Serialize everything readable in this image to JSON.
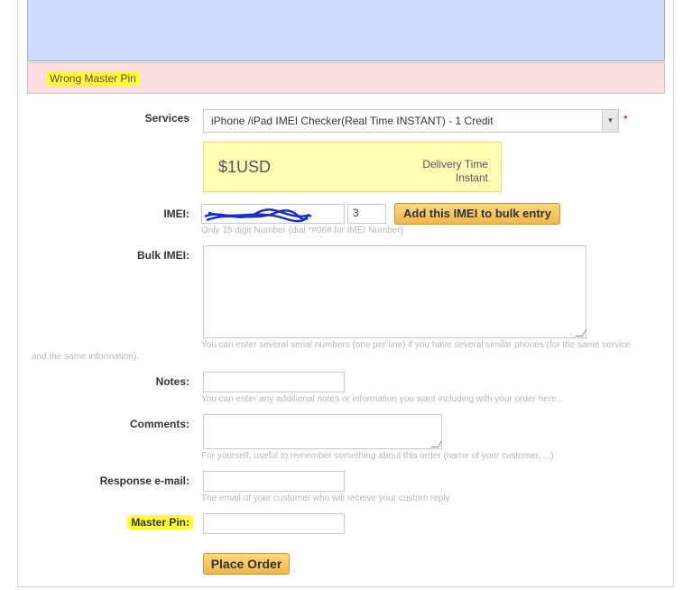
{
  "alert": {
    "message": "Wrong Master Pin"
  },
  "services": {
    "label": "Services",
    "selected": "iPhone /iPad IMEI Checker(Real Time INSTANT) - 1 Credit",
    "required_mark": "*"
  },
  "price": {
    "amount": "$1USD",
    "delivery_label": "Delivery Time",
    "delivery_value": "Instant"
  },
  "imei": {
    "label": "IMEI:",
    "value": "",
    "check_digit": "3",
    "add_button": "Add this IMEI to bulk entry",
    "hint": "Only 15 digit Number (dial *#06# for IMEI Number)"
  },
  "bulk": {
    "label": "Bulk IMEI:",
    "hint_line1": "You can enter several serial numbers (one per line) if you have several similar phones (for the same service",
    "hint_line2": "and the same information)."
  },
  "notes": {
    "label": "Notes:",
    "hint": "You can enter any additional notes or information you want including with your order here..."
  },
  "comments": {
    "label": "Comments:",
    "hint": "For yourself, useful to remember something about this order (name of your customer, ...)"
  },
  "response_email": {
    "label": "Response e-mail:",
    "hint": "The email of your customer who will receive your custom reply"
  },
  "master_pin": {
    "label": "Master Pin:"
  },
  "submit": {
    "label": "Place Order"
  },
  "colors": {
    "info_bg": "#cfdcff",
    "error_bg": "#fce0e1",
    "highlight": "#ffff33",
    "price_bg": "#ffffb6",
    "button": "#f2b64c"
  }
}
